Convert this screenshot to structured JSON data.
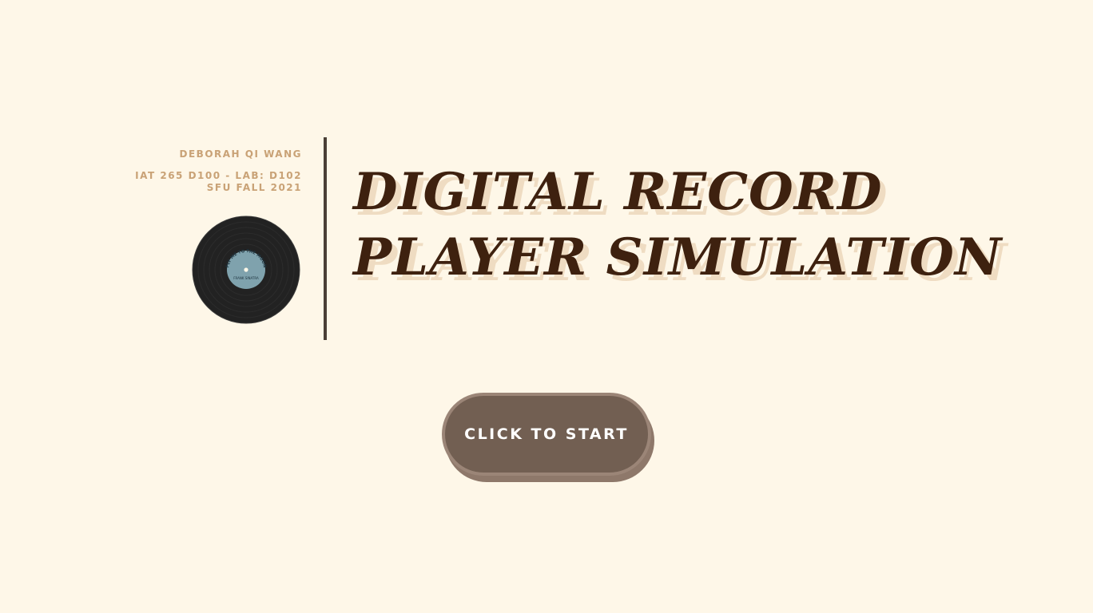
{
  "credits": {
    "author": "DEBORAH QI WANG",
    "course": "IAT 265 D100 - LAB: D102",
    "term": "SFU FALL 2021"
  },
  "record": {
    "label_top": "FLY ME TO THE MOON",
    "label_sub": "FRANK SINATRA",
    "vinyl_color": "#222222",
    "label_color": "#7fa2ad"
  },
  "title": {
    "line1": "DIGITAL RECORD",
    "line2": "PLAYER SIMULATION"
  },
  "start_button": {
    "label": "CLICK TO START"
  },
  "colors": {
    "background": "#fef7e8",
    "accent": "#c9a276",
    "title": "#3e210f",
    "button": "#725f52"
  }
}
